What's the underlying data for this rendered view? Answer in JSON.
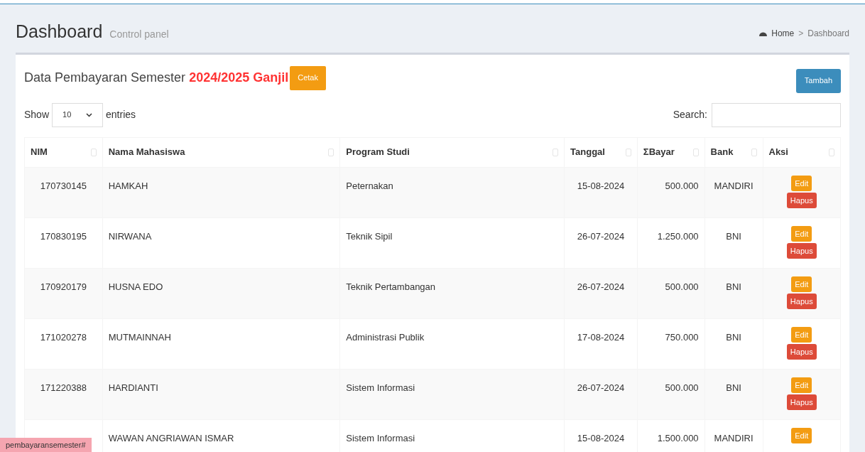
{
  "header": {
    "title": "Dashboard",
    "subtitle": "Control panel",
    "separator": ">",
    "breadcrumb": [
      {
        "label": "Home",
        "icon": true
      },
      {
        "label": "Dashboard",
        "icon": false
      }
    ]
  },
  "box": {
    "title": "Data Pembayaran Semester",
    "period": "2024/2025 Ganjil",
    "print_button": "Cetak",
    "add_button": "Tambah"
  },
  "length": {
    "prefix": "Show",
    "value": "10",
    "suffix": "entries"
  },
  "search": {
    "label": "Search:"
  },
  "table": {
    "columns": [
      "NIM",
      "Nama Mahasiswa",
      "Program Studi",
      "Tanggal",
      "ΣBayar",
      "Bank",
      "Aksi"
    ],
    "rows": [
      {
        "nim": "170730145",
        "name": "HAMKAH",
        "program": "Peternakan",
        "date": "15-08-2024",
        "amount": "500.000",
        "bank": "MANDIRI",
        "actions": [
          "Edit",
          "Hapus"
        ]
      },
      {
        "nim": "170830195",
        "name": "NIRWANA",
        "program": "Teknik Sipil",
        "date": "26-07-2024",
        "amount": "1.250.000",
        "bank": "BNI",
        "actions": [
          "Edit",
          "Hapus"
        ]
      },
      {
        "nim": "170920179",
        "name": "HUSNA EDO",
        "program": "Teknik Pertambangan",
        "date": "26-07-2024",
        "amount": "500.000",
        "bank": "BNI",
        "actions": [
          "Edit",
          "Hapus"
        ]
      },
      {
        "nim": "171020278",
        "name": "MUTMAINNAH",
        "program": "Administrasi Publik",
        "date": "17-08-2024",
        "amount": "750.000",
        "bank": "BNI",
        "actions": [
          "Edit",
          "Hapus"
        ]
      },
      {
        "nim": "171220388",
        "name": "HARDIANTI",
        "program": "Sistem Informasi",
        "date": "26-07-2024",
        "amount": "500.000",
        "bank": "BNI",
        "actions": [
          "Edit",
          "Hapus"
        ]
      },
      {
        "name": "WAWAN ANGRIAWAN ISMAR",
        "program": "Sistem Informasi",
        "date": "15-08-2024",
        "amount": "1.500.000",
        "bank": "MANDIRI",
        "actions": [
          "Edit"
        ]
      }
    ]
  },
  "status_link": "pembayaransemester#"
}
